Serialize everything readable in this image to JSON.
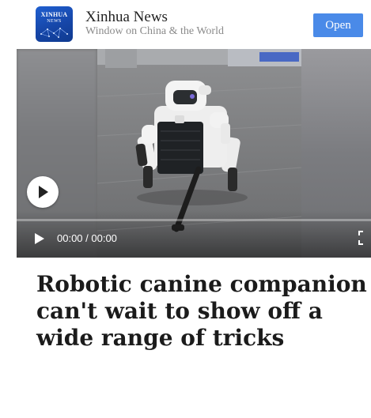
{
  "banner": {
    "logo_line1": "XINHUA",
    "logo_line2": "NEWS",
    "title": "Xinhua News",
    "subtitle": "Window on China & the World",
    "open_button": "Open"
  },
  "video": {
    "time_display": "00:00 / 00:00",
    "progress": 0
  },
  "article": {
    "headline": "Robotic canine companion can't wait to show off a wide range of tricks"
  },
  "colors": {
    "button_accent": "#4a8ae8",
    "logo_blue": "#1646a8",
    "headline_text": "#1b1b1b",
    "subtitle_text": "#8a8a8a"
  },
  "icons": [
    "app-logo-icon",
    "play-icon",
    "fullscreen-icon"
  ]
}
